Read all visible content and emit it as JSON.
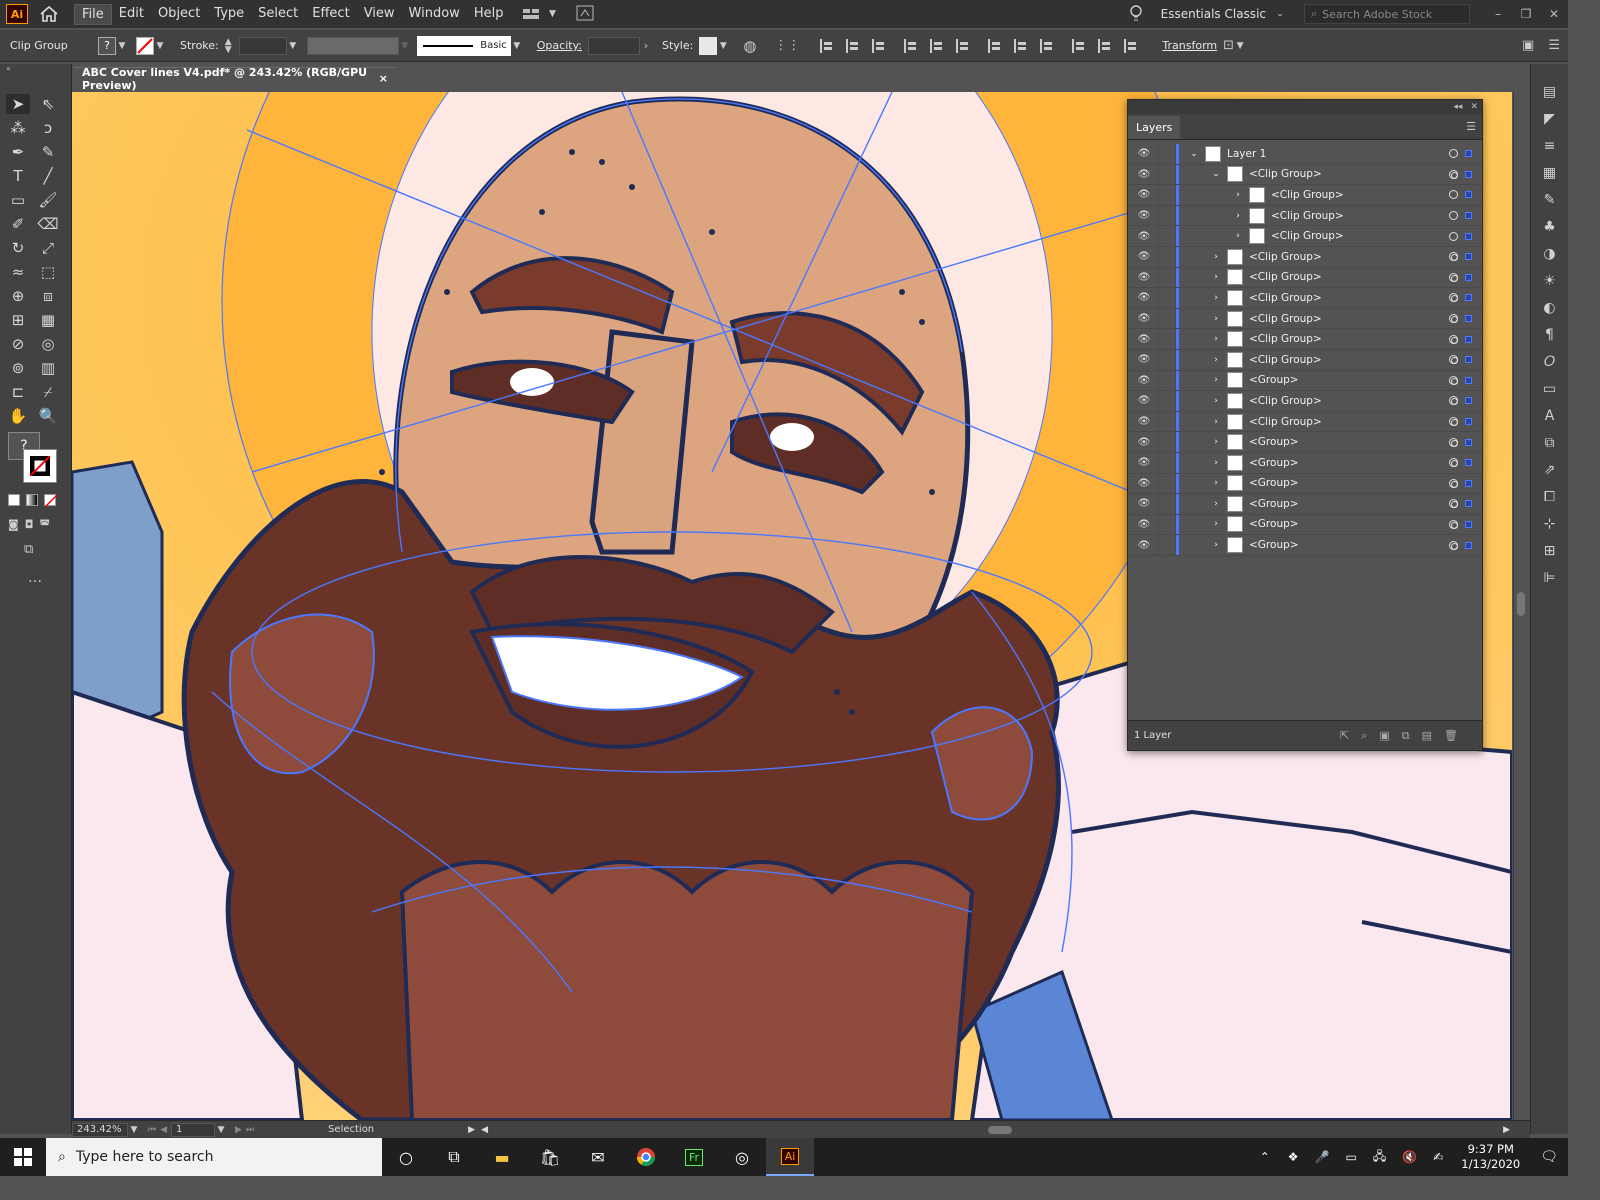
{
  "app": {
    "logo_text": "Ai",
    "menu": [
      "File",
      "Edit",
      "Object",
      "Type",
      "Select",
      "Effect",
      "View",
      "Window",
      "Help"
    ],
    "workspace": "Essentials Classic",
    "search_placeholder": "Search Adobe Stock"
  },
  "control_bar": {
    "selection_type": "Clip Group",
    "fill_value": "?",
    "stroke_label": "Stroke:",
    "stroke_style": "Basic",
    "opacity_label": "Opacity:",
    "style_label": "Style:",
    "transform_label": "Transform"
  },
  "document_tab": {
    "title": "ABC Cover lines V4.pdf* @ 243.42% (RGB/GPU Preview)",
    "close": "×"
  },
  "layers_panel": {
    "tab": "Layers",
    "rows": [
      {
        "name": "Layer 1",
        "level": 0,
        "expanded": true
      },
      {
        "name": "<Clip Group>",
        "level": 1,
        "expanded": true
      },
      {
        "name": "<Clip Group>",
        "level": 2,
        "expanded": false
      },
      {
        "name": "<Clip Group>",
        "level": 2,
        "expanded": false
      },
      {
        "name": "<Clip Group>",
        "level": 2,
        "expanded": false
      },
      {
        "name": "<Clip Group>",
        "level": 1,
        "expanded": false
      },
      {
        "name": "<Clip Group>",
        "level": 1,
        "expanded": false
      },
      {
        "name": "<Clip Group>",
        "level": 1,
        "expanded": false
      },
      {
        "name": "<Clip Group>",
        "level": 1,
        "expanded": false
      },
      {
        "name": "<Clip Group>",
        "level": 1,
        "expanded": false
      },
      {
        "name": "<Clip Group>",
        "level": 1,
        "expanded": false
      },
      {
        "name": "<Group>",
        "level": 1,
        "expanded": false
      },
      {
        "name": "<Clip Group>",
        "level": 1,
        "expanded": false
      },
      {
        "name": "<Clip Group>",
        "level": 1,
        "expanded": false
      },
      {
        "name": "<Group>",
        "level": 1,
        "expanded": false
      },
      {
        "name": "<Group>",
        "level": 1,
        "expanded": false
      },
      {
        "name": "<Group>",
        "level": 1,
        "expanded": false
      },
      {
        "name": "<Group>",
        "level": 1,
        "expanded": false
      },
      {
        "name": "<Group>",
        "level": 1,
        "expanded": false
      },
      {
        "name": "<Group>",
        "level": 1,
        "expanded": false
      }
    ],
    "footer_count": "1 Layer"
  },
  "status_bar": {
    "zoom": "243.42%",
    "artboard": "1",
    "tool": "Selection"
  },
  "taskbar": {
    "search_placeholder": "Type here to search",
    "time": "9:37 PM",
    "date": "1/13/2020",
    "pinned_apps": [
      "Task View",
      "File Explorer",
      "Microsoft Store",
      "Mail",
      "Chrome",
      "Adobe Fresco",
      "OBS",
      "Illustrator"
    ]
  },
  "colors": {
    "halo": "#fde8e4",
    "background": "#ffc043",
    "skin": "#d9a37d",
    "beard_dark": "#5e2d25",
    "beard_mid": "#8e4a3b",
    "outline": "#1f2a55",
    "path_blue": "#4b78ff",
    "shirt": "#fbe8ee"
  }
}
